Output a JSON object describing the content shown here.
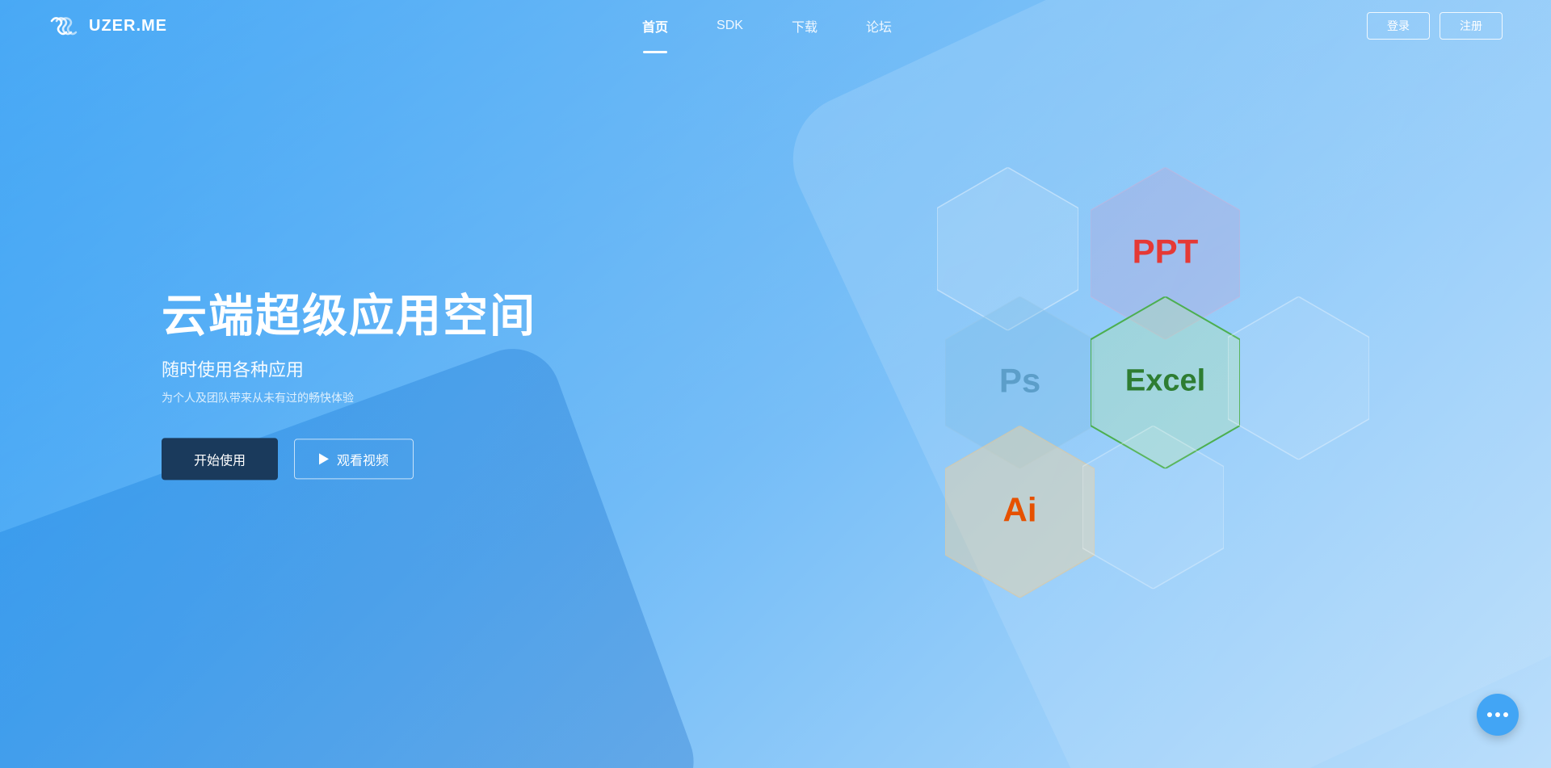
{
  "logo": {
    "text": "UZER.ME"
  },
  "nav": {
    "links": [
      {
        "id": "home",
        "label": "首页",
        "active": true
      },
      {
        "id": "sdk",
        "label": "SDK",
        "active": false
      },
      {
        "id": "download",
        "label": "下载",
        "active": false
      },
      {
        "id": "forum",
        "label": "论坛",
        "active": false
      }
    ],
    "login": "登录",
    "register": "注册"
  },
  "hero": {
    "title": "云端超级应用空间",
    "subtitle": "随时使用各种应用",
    "desc": "为个人及团队带来从未有过的畅快体验",
    "btn_start": "开始使用",
    "btn_video": "观看视频"
  },
  "hexagons": [
    {
      "id": "ppt",
      "label": "PPT",
      "color": "#e53935"
    },
    {
      "id": "ps",
      "label": "Ps",
      "color": "#5c9ec9"
    },
    {
      "id": "excel",
      "label": "Excel",
      "color": "#2e7d32"
    },
    {
      "id": "ai",
      "label": "Ai",
      "color": "#e65100"
    }
  ]
}
